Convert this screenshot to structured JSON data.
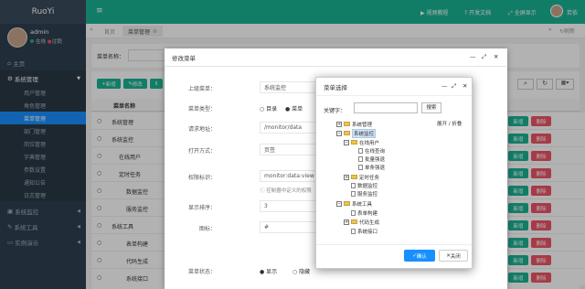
{
  "brand": "RuoYi",
  "user": {
    "name": "admin",
    "online": "在线",
    "logout": "注销"
  },
  "sidebar": {
    "home": "主页",
    "system": "系统管理",
    "sub": [
      "用户管理",
      "角色管理",
      "菜单管理",
      "部门管理",
      "岗位管理",
      "字典管理",
      "参数设置",
      "通知公告",
      "日志管理"
    ],
    "monitor": "系统监控",
    "tools": "系统工具",
    "demo": "实例演示"
  },
  "topbar": {
    "video": "视频教程",
    "docs": "开发文档",
    "fullscreen": "全屏显示",
    "user": "若依"
  },
  "tabs": {
    "home": "首页",
    "menu": "菜单管理",
    "refresh": "刷新"
  },
  "content": {
    "menu_name_label": "菜单名称：",
    "add": "新增",
    "edit": "修改",
    "col_menu": "菜单名称",
    "rows": [
      "系统管理",
      "系统监控",
      "在线用户",
      "定时任务",
      "数据监控",
      "服务监控",
      "系统工具",
      "表单构建",
      "代码生成",
      "系统接口"
    ],
    "row_add": "新增",
    "row_del": "删除"
  },
  "modal1": {
    "title": "修改菜单",
    "parent_label": "上级菜单：",
    "parent_value": "系统监控",
    "type_label": "菜单类型：",
    "type_options": [
      "目录",
      "菜单"
    ],
    "url_label": "请求地址：",
    "url_value": "/monitor/data",
    "open_label": "打开方式：",
    "open_value": "页签",
    "perm_label": "权限标识：",
    "perm_value": "monitor:data:view",
    "perm_help": "控制器中定义的权限",
    "order_label": "显示排序：",
    "order_value": "3",
    "icon_label": "图标：",
    "icon_value": "#",
    "status_label": "菜单状态：",
    "status_options": [
      "显示",
      "隐藏"
    ]
  },
  "modal2": {
    "title": "菜单选择",
    "kw_label": "关键字：",
    "search": "搜索",
    "expand": "展开 / 折叠",
    "tree": [
      "系统管理",
      "系统监控",
      "在线用户",
      "在线查询",
      "批量强退",
      "单条强退",
      "定时任务",
      "数据监控",
      "服务监控",
      "系统工具",
      "表单构建",
      "代码生成",
      "系统接口"
    ],
    "confirm": "确认",
    "close": "关闭"
  },
  "colors": {
    "sidebar": "#2f4050",
    "accent": "#1ab394",
    "primary": "#1890ff",
    "danger": "#ed5565"
  }
}
